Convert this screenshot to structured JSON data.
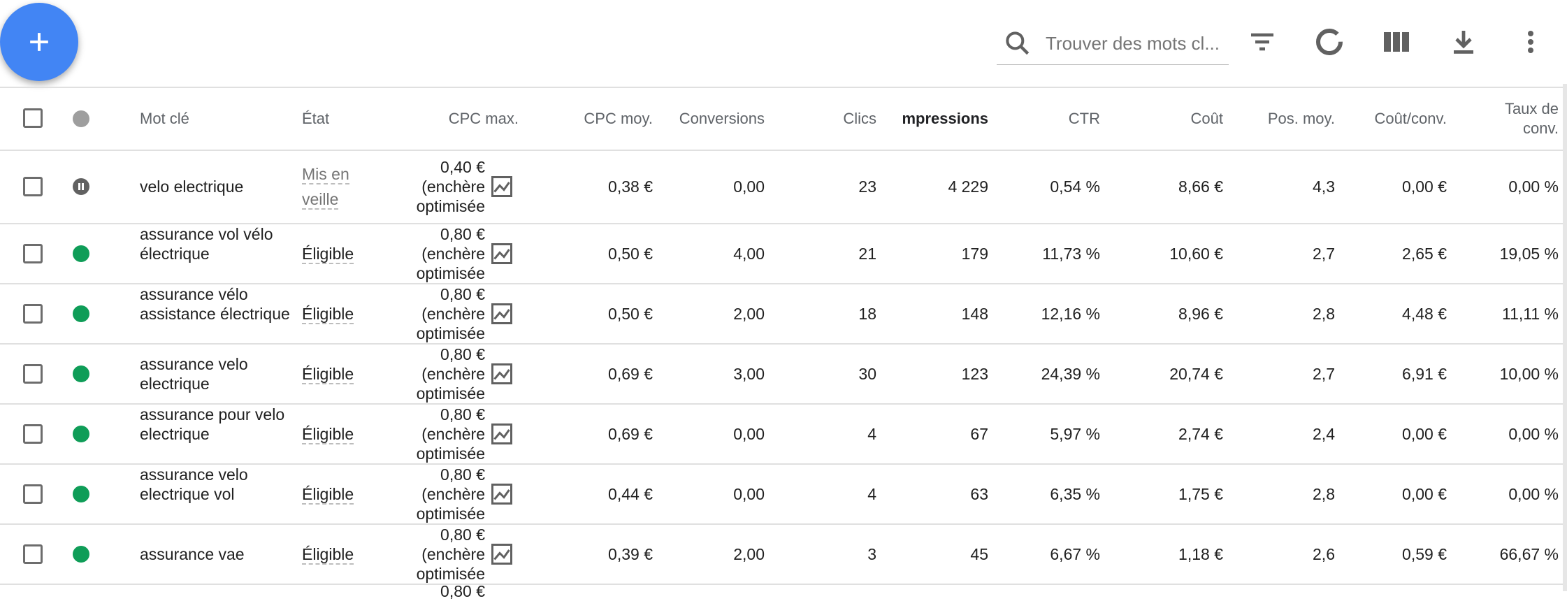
{
  "toolbar": {
    "add_icon": "plus-icon",
    "search_placeholder": "Trouver des mots cl...",
    "icons": [
      "search-icon",
      "filter-icon",
      "segment-icon",
      "columns-icon",
      "download-icon",
      "more-vert-icon"
    ]
  },
  "columns": [
    "Mot clé",
    "État",
    "CPC max.",
    "CPC moy.",
    "Conversions",
    "Clics",
    "mpressions",
    "CTR",
    "Coût",
    "Pos. moy.",
    "Coût/conv.",
    "Taux de",
    "conv."
  ],
  "rows": [
    {
      "status": "paused",
      "keyword": "velo electrique",
      "state": "Mis en veille",
      "cpc_max": [
        "0,40 €",
        "(enchère",
        "optimisée"
      ],
      "cpc_moy": "0,38 €",
      "conversions": "0,00",
      "clics": "23",
      "impressions": "4 229",
      "ctr": "0,54 %",
      "cout": "8,66 €",
      "pos": "4,3",
      "cout_conv": "0,00 €",
      "taux": "0,00 %"
    },
    {
      "status": "eligible",
      "keyword": "assurance vol vélo électrique",
      "state": "Éligible",
      "cpc_max": [
        "0,80 €",
        "(enchère",
        "optimisée"
      ],
      "cpc_moy": "0,50 €",
      "conversions": "4,00",
      "clics": "21",
      "impressions": "179",
      "ctr": "11,73 %",
      "cout": "10,60 €",
      "pos": "2,7",
      "cout_conv": "2,65 €",
      "taux": "19,05 %"
    },
    {
      "status": "eligible",
      "keyword": "assurance vélo assistance électrique",
      "state": "Éligible",
      "cpc_max": [
        "0,80 €",
        "(enchère",
        "optimisée"
      ],
      "cpc_moy": "0,50 €",
      "conversions": "2,00",
      "clics": "18",
      "impressions": "148",
      "ctr": "12,16 %",
      "cout": "8,96 €",
      "pos": "2,8",
      "cout_conv": "4,48 €",
      "taux": "11,11 %"
    },
    {
      "status": "eligible",
      "keyword": "assurance velo electrique",
      "state": "Éligible",
      "cpc_max": [
        "0,80 €",
        "(enchère",
        "optimisée"
      ],
      "cpc_moy": "0,69 €",
      "conversions": "3,00",
      "clics": "30",
      "impressions": "123",
      "ctr": "24,39 %",
      "cout": "20,74 €",
      "pos": "2,7",
      "cout_conv": "6,91 €",
      "taux": "10,00 %"
    },
    {
      "status": "eligible",
      "keyword": "assurance pour velo electrique",
      "state": "Éligible",
      "cpc_max": [
        "0,80 €",
        "(enchère",
        "optimisée"
      ],
      "cpc_moy": "0,69 €",
      "conversions": "0,00",
      "clics": "4",
      "impressions": "67",
      "ctr": "5,97 %",
      "cout": "2,74 €",
      "pos": "2,4",
      "cout_conv": "0,00 €",
      "taux": "0,00 %"
    },
    {
      "status": "eligible",
      "keyword": "assurance velo electrique vol",
      "state": "Éligible",
      "cpc_max": [
        "0,80 €",
        "(enchère",
        "optimisée"
      ],
      "cpc_moy": "0,44 €",
      "conversions": "0,00",
      "clics": "4",
      "impressions": "63",
      "ctr": "6,35 %",
      "cout": "1,75 €",
      "pos": "2,8",
      "cout_conv": "0,00 €",
      "taux": "0,00 %"
    },
    {
      "status": "eligible",
      "keyword": "assurance vae",
      "state": "Éligible",
      "cpc_max": [
        "0,80 €",
        "(enchère",
        "optimisée"
      ],
      "cpc_moy": "0,39 €",
      "conversions": "2,00",
      "clics": "3",
      "impressions": "45",
      "ctr": "6,67 %",
      "cout": "1,18 €",
      "pos": "2,6",
      "cout_conv": "0,59 €",
      "taux": "66,67 %"
    }
  ],
  "partial_row": {
    "cpc_max": "0,80 €"
  }
}
